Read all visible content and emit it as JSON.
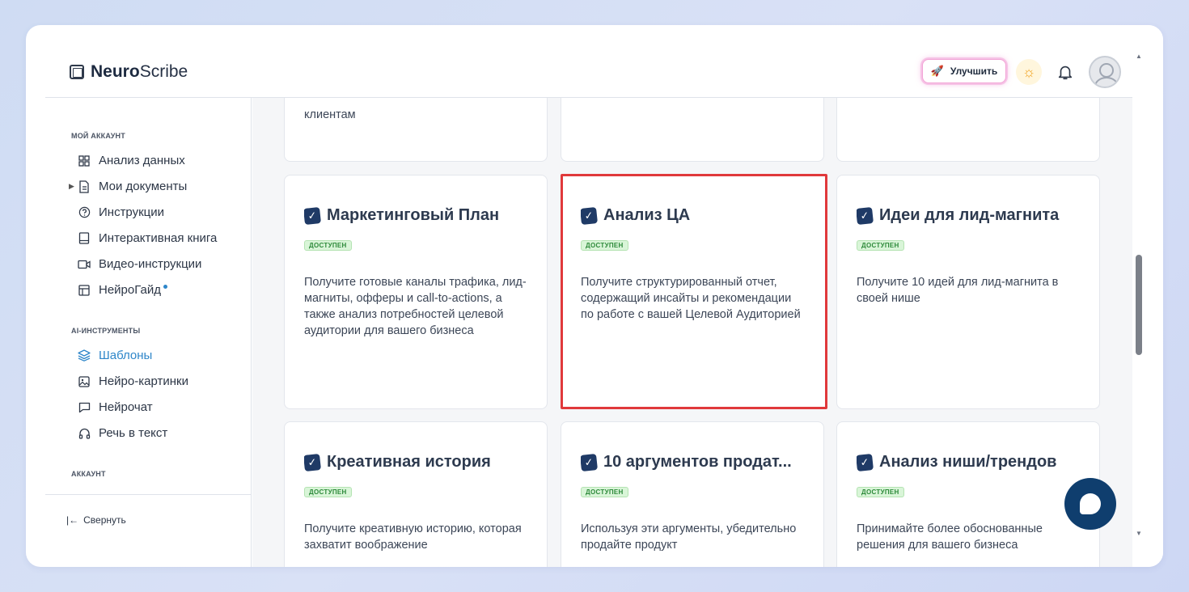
{
  "header": {
    "logo_bold": "Neuro",
    "logo_regular": "Scribe",
    "upgrade_label": "Улучшить"
  },
  "sidebar": {
    "section_my_account": "МОЙ АККАУНТ",
    "items_account": [
      {
        "label": "Анализ данных",
        "icon": "grid-icon"
      },
      {
        "label": "Мои документы",
        "icon": "document-icon"
      },
      {
        "label": "Инструкции",
        "icon": "help-circle-icon"
      },
      {
        "label": "Интерактивная книга",
        "icon": "book-icon"
      },
      {
        "label": "Видео-инструкции",
        "icon": "video-icon"
      },
      {
        "label": "НейроГайд",
        "icon": "table-icon"
      }
    ],
    "section_ai_tools": "AI-ИНСТРУМЕНТЫ",
    "items_ai": [
      {
        "label": "Шаблоны",
        "icon": "layers-icon",
        "active": true
      },
      {
        "label": "Нейро-картинки",
        "icon": "image-icon"
      },
      {
        "label": "Нейрочат",
        "icon": "chat-icon"
      },
      {
        "label": "Речь в текст",
        "icon": "headphones-icon"
      }
    ],
    "section_account": "АККАУНТ",
    "collapse_label": "Свернуть"
  },
  "content": {
    "top_row_partial": [
      "клиентам",
      "",
      ""
    ],
    "cards": [
      {
        "title": "Маркетинговый План",
        "badge": "ДОСТУПЕН",
        "desc": "Получите готовые каналы трафика, лид-магниты, офферы и call-to-actions, а также анализ потребностей целевой аудитории для вашего бизнеса"
      },
      {
        "title": "Анализ ЦА",
        "badge": "ДОСТУПЕН",
        "desc": "Получите структурированный отчет, содержащий инсайты и рекомендации по работе с вашей Целевой Аудиторией"
      },
      {
        "title": "Идеи для лид-магнита",
        "badge": "ДОСТУПЕН",
        "desc": "Получите 10 идей для лид-магнита в своей нише"
      },
      {
        "title": "Креативная история",
        "badge": "ДОСТУПЕН",
        "desc": "Получите креативную историю, которая захватит воображение"
      },
      {
        "title": "10 аргументов продат...",
        "badge": "ДОСТУПЕН",
        "desc": "Используя эти аргументы, убедительно продайте продукт"
      },
      {
        "title": "Анализ ниши/трендов",
        "badge": "ДОСТУПЕН",
        "desc": "Принимайте более обоснованные решения для вашего бизнеса"
      }
    ]
  }
}
